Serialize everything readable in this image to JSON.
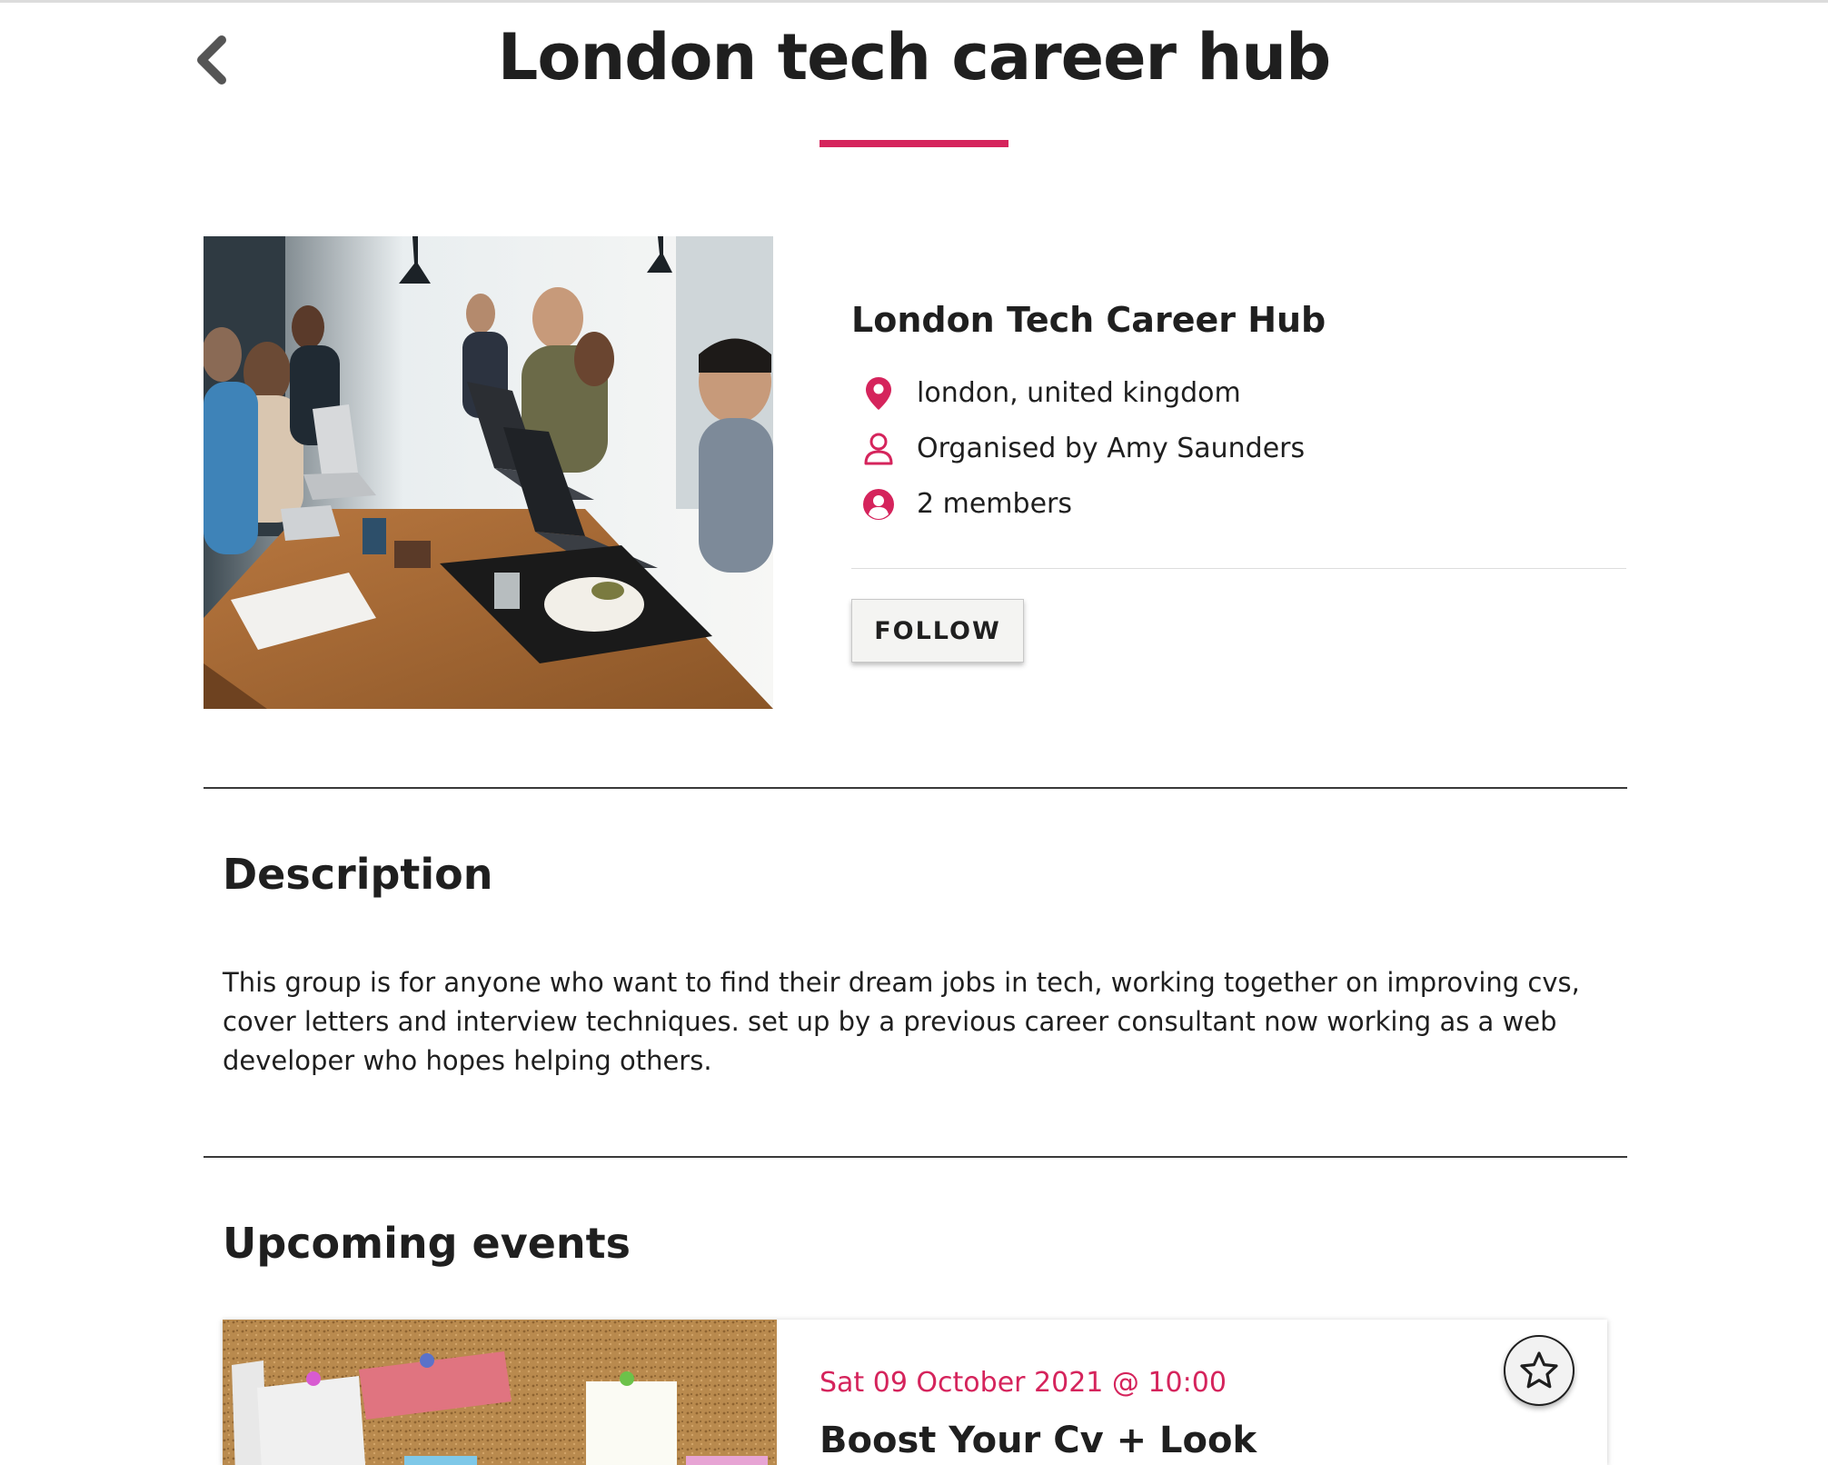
{
  "header": {
    "title": "London tech career hub",
    "back_icon": "chevron-left-icon"
  },
  "group": {
    "name": "London Tech Career Hub",
    "location": "london, united kingdom",
    "organiser": "Organised by Amy Saunders",
    "members": "2 members",
    "follow_label": "FOLLOW",
    "photo_alt": "people working on laptops at a long table",
    "icons": [
      "location-pin-icon",
      "user-outline-icon",
      "user-circle-icon"
    ]
  },
  "description": {
    "heading": "Description",
    "text": "This group is for anyone who want to find their dream jobs in tech, working together on improving cvs, cover letters and interview techniques. set up by a previous career consultant now working as a web developer who hopes helping others."
  },
  "events": {
    "heading": "Upcoming events",
    "items": [
      {
        "date": "Sat 09 October 2021 @ 10:00",
        "title": "Boost Your Cv + Look",
        "image_alt": "cork board with pinned notes",
        "favourite_icon": "star-outline-icon"
      }
    ]
  },
  "colors": {
    "accent": "#d5245c",
    "text": "#1f1f1f"
  }
}
